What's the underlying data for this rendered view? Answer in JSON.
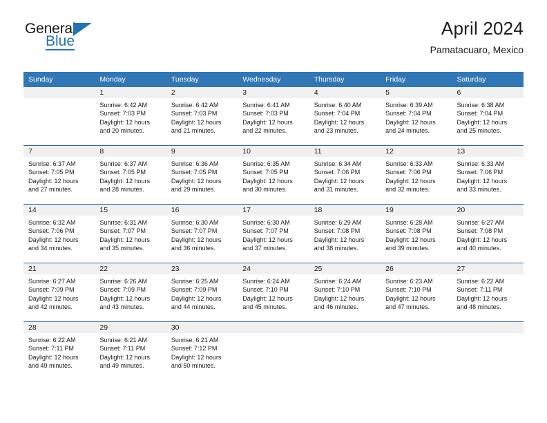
{
  "brand": {
    "name_dark": "General",
    "name_blue": "Blue",
    "accent_color": "#2272b8",
    "triangle_icon": "triangle-icon"
  },
  "header": {
    "title": "April 2024",
    "subtitle": "Pamatacuaro, Mexico"
  },
  "calendar": {
    "header_bg": "#3176b5",
    "daynum_bg": "#f0f0f0",
    "weekday_headers": [
      "Sunday",
      "Monday",
      "Tuesday",
      "Wednesday",
      "Thursday",
      "Friday",
      "Saturday"
    ],
    "weeks": [
      [
        {
          "day": "",
          "sunrise": "",
          "sunset": "",
          "daylight_line1": "",
          "daylight_line2": ""
        },
        {
          "day": "1",
          "sunrise": "Sunrise: 6:42 AM",
          "sunset": "Sunset: 7:03 PM",
          "daylight_line1": "Daylight: 12 hours",
          "daylight_line2": "and 20 minutes."
        },
        {
          "day": "2",
          "sunrise": "Sunrise: 6:42 AM",
          "sunset": "Sunset: 7:03 PM",
          "daylight_line1": "Daylight: 12 hours",
          "daylight_line2": "and 21 minutes."
        },
        {
          "day": "3",
          "sunrise": "Sunrise: 6:41 AM",
          "sunset": "Sunset: 7:03 PM",
          "daylight_line1": "Daylight: 12 hours",
          "daylight_line2": "and 22 minutes."
        },
        {
          "day": "4",
          "sunrise": "Sunrise: 6:40 AM",
          "sunset": "Sunset: 7:04 PM",
          "daylight_line1": "Daylight: 12 hours",
          "daylight_line2": "and 23 minutes."
        },
        {
          "day": "5",
          "sunrise": "Sunrise: 6:39 AM",
          "sunset": "Sunset: 7:04 PM",
          "daylight_line1": "Daylight: 12 hours",
          "daylight_line2": "and 24 minutes."
        },
        {
          "day": "6",
          "sunrise": "Sunrise: 6:38 AM",
          "sunset": "Sunset: 7:04 PM",
          "daylight_line1": "Daylight: 12 hours",
          "daylight_line2": "and 25 minutes."
        }
      ],
      [
        {
          "day": "7",
          "sunrise": "Sunrise: 6:37 AM",
          "sunset": "Sunset: 7:05 PM",
          "daylight_line1": "Daylight: 12 hours",
          "daylight_line2": "and 27 minutes."
        },
        {
          "day": "8",
          "sunrise": "Sunrise: 6:37 AM",
          "sunset": "Sunset: 7:05 PM",
          "daylight_line1": "Daylight: 12 hours",
          "daylight_line2": "and 28 minutes."
        },
        {
          "day": "9",
          "sunrise": "Sunrise: 6:36 AM",
          "sunset": "Sunset: 7:05 PM",
          "daylight_line1": "Daylight: 12 hours",
          "daylight_line2": "and 29 minutes."
        },
        {
          "day": "10",
          "sunrise": "Sunrise: 6:35 AM",
          "sunset": "Sunset: 7:05 PM",
          "daylight_line1": "Daylight: 12 hours",
          "daylight_line2": "and 30 minutes."
        },
        {
          "day": "11",
          "sunrise": "Sunrise: 6:34 AM",
          "sunset": "Sunset: 7:06 PM",
          "daylight_line1": "Daylight: 12 hours",
          "daylight_line2": "and 31 minutes."
        },
        {
          "day": "12",
          "sunrise": "Sunrise: 6:33 AM",
          "sunset": "Sunset: 7:06 PM",
          "daylight_line1": "Daylight: 12 hours",
          "daylight_line2": "and 32 minutes."
        },
        {
          "day": "13",
          "sunrise": "Sunrise: 6:33 AM",
          "sunset": "Sunset: 7:06 PM",
          "daylight_line1": "Daylight: 12 hours",
          "daylight_line2": "and 33 minutes."
        }
      ],
      [
        {
          "day": "14",
          "sunrise": "Sunrise: 6:32 AM",
          "sunset": "Sunset: 7:06 PM",
          "daylight_line1": "Daylight: 12 hours",
          "daylight_line2": "and 34 minutes."
        },
        {
          "day": "15",
          "sunrise": "Sunrise: 6:31 AM",
          "sunset": "Sunset: 7:07 PM",
          "daylight_line1": "Daylight: 12 hours",
          "daylight_line2": "and 35 minutes."
        },
        {
          "day": "16",
          "sunrise": "Sunrise: 6:30 AM",
          "sunset": "Sunset: 7:07 PM",
          "daylight_line1": "Daylight: 12 hours",
          "daylight_line2": "and 36 minutes."
        },
        {
          "day": "17",
          "sunrise": "Sunrise: 6:30 AM",
          "sunset": "Sunset: 7:07 PM",
          "daylight_line1": "Daylight: 12 hours",
          "daylight_line2": "and 37 minutes."
        },
        {
          "day": "18",
          "sunrise": "Sunrise: 6:29 AM",
          "sunset": "Sunset: 7:08 PM",
          "daylight_line1": "Daylight: 12 hours",
          "daylight_line2": "and 38 minutes."
        },
        {
          "day": "19",
          "sunrise": "Sunrise: 6:28 AM",
          "sunset": "Sunset: 7:08 PM",
          "daylight_line1": "Daylight: 12 hours",
          "daylight_line2": "and 39 minutes."
        },
        {
          "day": "20",
          "sunrise": "Sunrise: 6:27 AM",
          "sunset": "Sunset: 7:08 PM",
          "daylight_line1": "Daylight: 12 hours",
          "daylight_line2": "and 40 minutes."
        }
      ],
      [
        {
          "day": "21",
          "sunrise": "Sunrise: 6:27 AM",
          "sunset": "Sunset: 7:09 PM",
          "daylight_line1": "Daylight: 12 hours",
          "daylight_line2": "and 42 minutes."
        },
        {
          "day": "22",
          "sunrise": "Sunrise: 6:26 AM",
          "sunset": "Sunset: 7:09 PM",
          "daylight_line1": "Daylight: 12 hours",
          "daylight_line2": "and 43 minutes."
        },
        {
          "day": "23",
          "sunrise": "Sunrise: 6:25 AM",
          "sunset": "Sunset: 7:09 PM",
          "daylight_line1": "Daylight: 12 hours",
          "daylight_line2": "and 44 minutes."
        },
        {
          "day": "24",
          "sunrise": "Sunrise: 6:24 AM",
          "sunset": "Sunset: 7:10 PM",
          "daylight_line1": "Daylight: 12 hours",
          "daylight_line2": "and 45 minutes."
        },
        {
          "day": "25",
          "sunrise": "Sunrise: 6:24 AM",
          "sunset": "Sunset: 7:10 PM",
          "daylight_line1": "Daylight: 12 hours",
          "daylight_line2": "and 46 minutes."
        },
        {
          "day": "26",
          "sunrise": "Sunrise: 6:23 AM",
          "sunset": "Sunset: 7:10 PM",
          "daylight_line1": "Daylight: 12 hours",
          "daylight_line2": "and 47 minutes."
        },
        {
          "day": "27",
          "sunrise": "Sunrise: 6:22 AM",
          "sunset": "Sunset: 7:11 PM",
          "daylight_line1": "Daylight: 12 hours",
          "daylight_line2": "and 48 minutes."
        }
      ],
      [
        {
          "day": "28",
          "sunrise": "Sunrise: 6:22 AM",
          "sunset": "Sunset: 7:11 PM",
          "daylight_line1": "Daylight: 12 hours",
          "daylight_line2": "and 49 minutes."
        },
        {
          "day": "29",
          "sunrise": "Sunrise: 6:21 AM",
          "sunset": "Sunset: 7:11 PM",
          "daylight_line1": "Daylight: 12 hours",
          "daylight_line2": "and 49 minutes."
        },
        {
          "day": "30",
          "sunrise": "Sunrise: 6:21 AM",
          "sunset": "Sunset: 7:12 PM",
          "daylight_line1": "Daylight: 12 hours",
          "daylight_line2": "and 50 minutes."
        },
        {
          "day": "",
          "sunrise": "",
          "sunset": "",
          "daylight_line1": "",
          "daylight_line2": ""
        },
        {
          "day": "",
          "sunrise": "",
          "sunset": "",
          "daylight_line1": "",
          "daylight_line2": ""
        },
        {
          "day": "",
          "sunrise": "",
          "sunset": "",
          "daylight_line1": "",
          "daylight_line2": ""
        },
        {
          "day": "",
          "sunrise": "",
          "sunset": "",
          "daylight_line1": "",
          "daylight_line2": ""
        }
      ]
    ]
  }
}
